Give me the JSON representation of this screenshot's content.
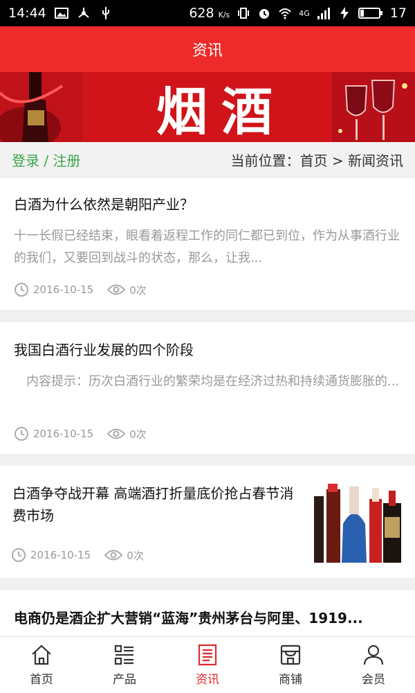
{
  "status": {
    "time": "14:44",
    "speed": "628",
    "speed_unit": "K/s",
    "net": "4G",
    "battery": "17"
  },
  "header": {
    "title": "资讯"
  },
  "banner": {
    "text": "烟酒"
  },
  "crumb": {
    "login": "登录 / 注册",
    "location": "当前位置：首页 > 新闻资讯"
  },
  "articles": [
    {
      "title": "白酒为什么依然是朝阳产业？",
      "summary": "十一长假已经结束，眼看着返程工作的同仁都已到位，作为从事酒行业的我们，又要回到战斗的状态，那么，让我...",
      "date": "2016-10-15",
      "views": "0次"
    },
    {
      "title": "我国白酒行业发展的四个阶段",
      "summary": "　内容提示：历次白酒行业的繁荣均是在经济过热和持续通货膨胀的...",
      "date": "2016-10-15",
      "views": "0次"
    },
    {
      "title": "白酒争夺战开幕 高端酒打折量底价抢占春节消费市场",
      "date": "2016-10-15",
      "views": "0次"
    },
    {
      "title": "电商仍是酒企扩大营销“蓝海”贵州茅台与阿里、1919..."
    }
  ],
  "tabs": [
    {
      "label": "首页",
      "icon": "home-icon"
    },
    {
      "label": "产品",
      "icon": "list-icon"
    },
    {
      "label": "资讯",
      "icon": "news-icon",
      "active": true
    },
    {
      "label": "商铺",
      "icon": "shop-icon"
    },
    {
      "label": "会员",
      "icon": "user-icon"
    }
  ],
  "colors": {
    "brand": "#ee2a2a",
    "active": "#e0282d",
    "login": "#3aa64a"
  }
}
